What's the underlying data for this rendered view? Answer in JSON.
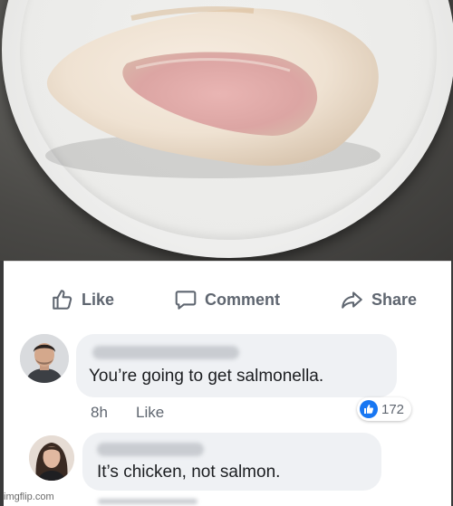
{
  "post_actions": {
    "like_label": "Like",
    "comment_label": "Comment",
    "share_label": "Share"
  },
  "comments": [
    {
      "text": "You’re going to get salmonella.",
      "time": "8h",
      "like_label": "Like",
      "reaction_count": "172"
    },
    {
      "text": "It’s chicken, not salmon."
    }
  ],
  "watermark": "imgflip.com",
  "colors": {
    "facebook_blue": "#1877f2",
    "action_gray": "#5f6670",
    "bubble_bg": "#eff1f4"
  }
}
